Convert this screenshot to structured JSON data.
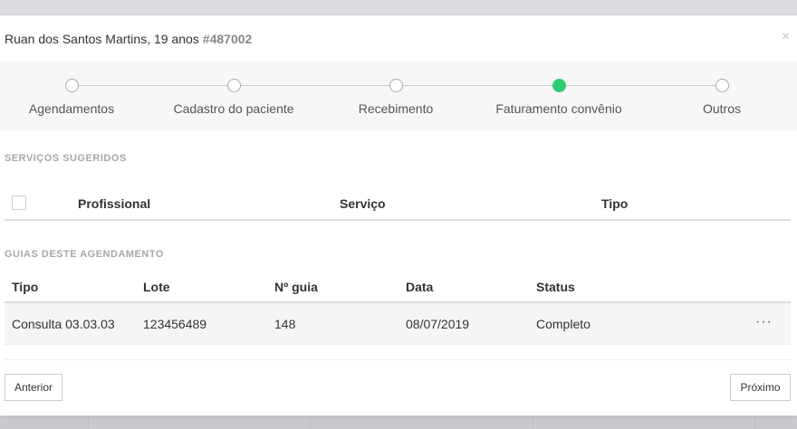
{
  "modal": {
    "title": "Ruan dos Santos Martins, 19 anos",
    "code": "#487002",
    "close_glyph": "×"
  },
  "stepper": {
    "steps": [
      {
        "label": "Agendamentos",
        "active": false
      },
      {
        "label": "Cadastro do paciente",
        "active": false
      },
      {
        "label": "Recebimento",
        "active": false
      },
      {
        "label": "Faturamento convênio",
        "active": true
      },
      {
        "label": "Outros",
        "active": false
      }
    ]
  },
  "suggested": {
    "section_label": "SERVIÇOS SUGERIDOS",
    "columns": [
      "Profissional",
      "Serviço",
      "Tipo"
    ]
  },
  "guides": {
    "section_label": "GUIAS DESTE AGENDAMENTO",
    "columns": [
      "Tipo",
      "Lote",
      "Nº guia",
      "Data",
      "Status"
    ],
    "rows": [
      {
        "tipo": "Consulta 03.03.03",
        "lote": "123456489",
        "guia": "148",
        "data": "08/07/2019",
        "status": "Completo",
        "more": "···"
      }
    ]
  },
  "footer": {
    "prev_label": "Anterior",
    "next_label": "Próximo"
  },
  "colors": {
    "active_step": "#2ecc71",
    "section_label": "#a7a7a7"
  }
}
